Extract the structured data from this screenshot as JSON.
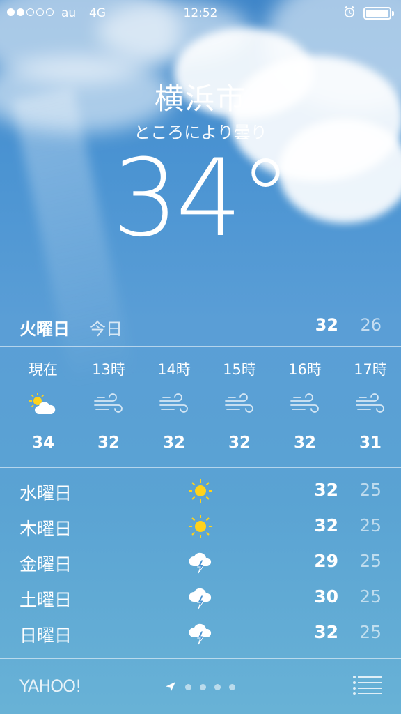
{
  "status_bar": {
    "carrier": "au",
    "network": "4G",
    "time": "12:52",
    "signal_bars_filled": 2,
    "signal_bars_total": 5
  },
  "location": {
    "city": "横浜市",
    "condition": "ところにより曇り",
    "temperature": "34°"
  },
  "today": {
    "day": "火曜日",
    "label": "今日",
    "high": "32",
    "low": "26"
  },
  "hourly": [
    {
      "time": "現在",
      "icon": "partly-cloudy-sun-icon",
      "temp": "34"
    },
    {
      "time": "13時",
      "icon": "wind-icon",
      "temp": "32"
    },
    {
      "time": "14時",
      "icon": "wind-icon",
      "temp": "32"
    },
    {
      "time": "15時",
      "icon": "wind-icon",
      "temp": "32"
    },
    {
      "time": "16時",
      "icon": "wind-icon",
      "temp": "32"
    },
    {
      "time": "17時",
      "icon": "wind-icon",
      "temp": "31"
    }
  ],
  "daily": [
    {
      "day": "水曜日",
      "icon": "sun-icon",
      "high": "32",
      "low": "25"
    },
    {
      "day": "木曜日",
      "icon": "sun-icon",
      "high": "32",
      "low": "25"
    },
    {
      "day": "金曜日",
      "icon": "thunderstorm-icon",
      "high": "29",
      "low": "25"
    },
    {
      "day": "土曜日",
      "icon": "thunderstorm-icon",
      "high": "30",
      "low": "25"
    },
    {
      "day": "日曜日",
      "icon": "thunderstorm-icon",
      "high": "32",
      "low": "25"
    }
  ],
  "footer": {
    "brand": "YAHOO!",
    "page_count": 4
  },
  "colors": {
    "sky_top": "#3f86c9",
    "sky_bottom": "#68b2d6",
    "sun": "#ffd21a"
  }
}
